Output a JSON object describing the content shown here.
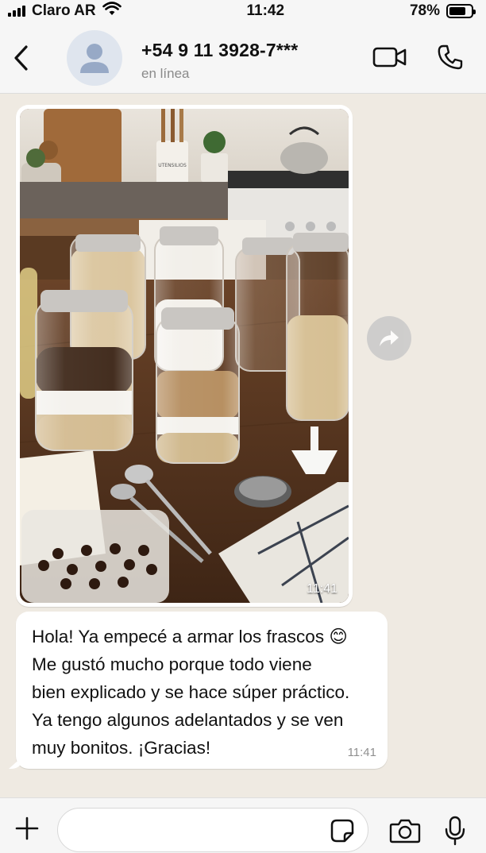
{
  "status_bar": {
    "carrier": "Claro AR",
    "time": "11:42",
    "battery_percent": "78%",
    "battery_level": 0.78
  },
  "header": {
    "contact_name": "+54 9 11 3928-7***",
    "contact_status": "en línea"
  },
  "messages": [
    {
      "type": "image",
      "time": "11:41",
      "caption_icon": "forward-icon",
      "photo_label": "UTENSILIOS"
    },
    {
      "type": "text",
      "text": "Hola! Ya empecé a armar los frascos 😊\nMe gustó mucho porque todo viene\nbien explicado y se hace súper práctico.\nYa tengo algunos adelantados y se ven\nmuy bonitos. ¡Gracias!",
      "time": "11:41"
    }
  ],
  "input_bar": {
    "placeholder": ""
  },
  "icons": {
    "back": "chevron-left-icon",
    "avatar": "person-icon",
    "video": "video-camera-icon",
    "call": "phone-icon",
    "plus": "plus-icon",
    "sticker": "sticker-icon",
    "camera": "camera-icon",
    "mic": "microphone-icon"
  },
  "colors": {
    "chat_background": "#efeae2",
    "bubble": "#ffffff",
    "header": "#f6f6f6"
  }
}
